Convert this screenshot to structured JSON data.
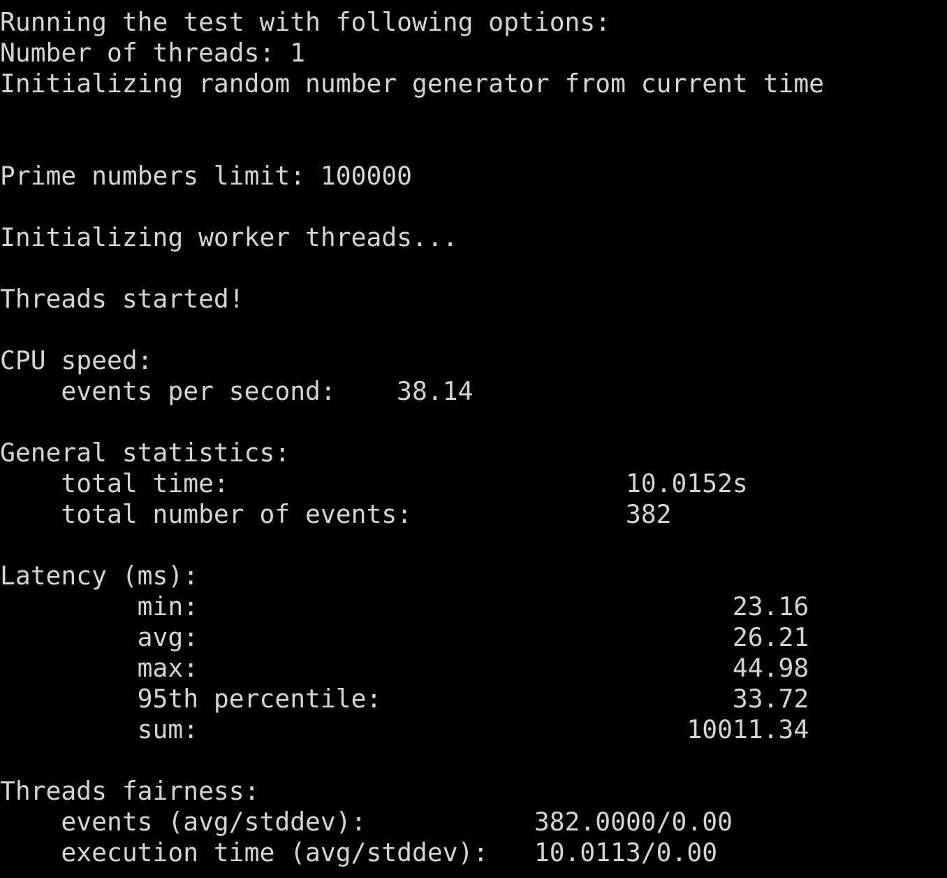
{
  "terminal": {
    "lines": [
      "Running the test with following options:",
      "Number of threads: 1",
      "Initializing random number generator from current time",
      "",
      "",
      "Prime numbers limit: 100000",
      "",
      "Initializing worker threads...",
      "",
      "Threads started!",
      "",
      "CPU speed:",
      "    events per second:    38.14",
      "",
      "General statistics:",
      "    total time:                          10.0152s",
      "    total number of events:              382",
      "",
      "Latency (ms):",
      "         min:                                   23.16",
      "         avg:                                   26.21",
      "         max:                                   44.98",
      "         95th percentile:                       33.72",
      "         sum:                                10011.34",
      "",
      "Threads fairness:",
      "    events (avg/stddev):           382.0000/0.00",
      "    execution time (avg/stddev):   10.0113/0.00"
    ]
  }
}
